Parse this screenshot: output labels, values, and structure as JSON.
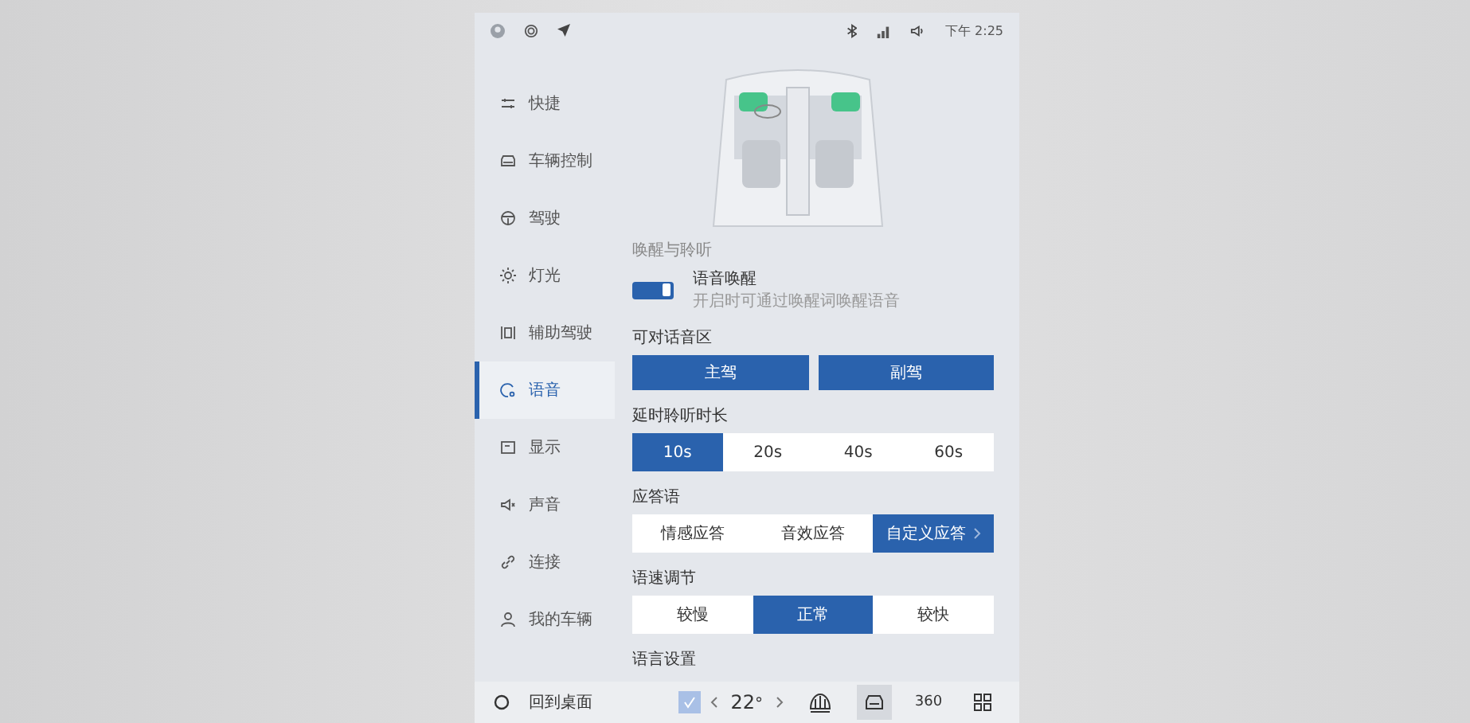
{
  "status_bar": {
    "time": "下午 2:25"
  },
  "sidebar": {
    "items": [
      {
        "label": "快捷",
        "kind": "sliders",
        "selected": false
      },
      {
        "label": "车辆控制",
        "kind": "car",
        "selected": false
      },
      {
        "label": "驾驶",
        "kind": "wheel",
        "selected": false
      },
      {
        "label": "灯光",
        "kind": "sun",
        "selected": false
      },
      {
        "label": "辅助驾驶",
        "kind": "lane",
        "selected": false
      },
      {
        "label": "语音",
        "kind": "voice",
        "selected": true
      },
      {
        "label": "显示",
        "kind": "display",
        "selected": false
      },
      {
        "label": "声音",
        "kind": "speaker",
        "selected": false
      },
      {
        "label": "连接",
        "kind": "link",
        "selected": false
      },
      {
        "label": "我的车辆",
        "kind": "person",
        "selected": false
      }
    ]
  },
  "content": {
    "wake": {
      "title": "唤醒与聆听",
      "label": "语音唤醒",
      "description": "开启时可通过唤醒词唤醒语音",
      "on": true
    },
    "sections": [
      {
        "title": "可对话音区",
        "kind": "split",
        "options": [
          {
            "label": "主驾",
            "selected": true
          },
          {
            "label": "副驾",
            "selected": true
          }
        ]
      },
      {
        "title": "延时聆听时长",
        "kind": "segment",
        "options": [
          {
            "label": "10s",
            "selected": true
          },
          {
            "label": "20s",
            "selected": false
          },
          {
            "label": "40s",
            "selected": false
          },
          {
            "label": "60s",
            "selected": false
          }
        ]
      },
      {
        "title": "应答语",
        "kind": "segment",
        "options": [
          {
            "label": "情感应答",
            "selected": false,
            "arrow": false
          },
          {
            "label": "音效应答",
            "selected": false,
            "arrow": false
          },
          {
            "label": "自定义应答",
            "selected": true,
            "arrow": true
          }
        ]
      },
      {
        "title": "语速调节",
        "kind": "segment",
        "options": [
          {
            "label": "较慢",
            "selected": false
          },
          {
            "label": "正常",
            "selected": true
          },
          {
            "label": "较快",
            "selected": false
          }
        ]
      }
    ],
    "footer_title": "语言设置"
  },
  "dock": {
    "home_label": "回到桌面",
    "temperature": "22",
    "temperature_unit": "°",
    "camera_label": "360",
    "items": [
      {
        "kind": "defrost",
        "selected": false
      },
      {
        "kind": "car",
        "selected": true
      },
      {
        "kind": "camera",
        "selected": false
      },
      {
        "kind": "apps",
        "selected": false
      }
    ]
  }
}
